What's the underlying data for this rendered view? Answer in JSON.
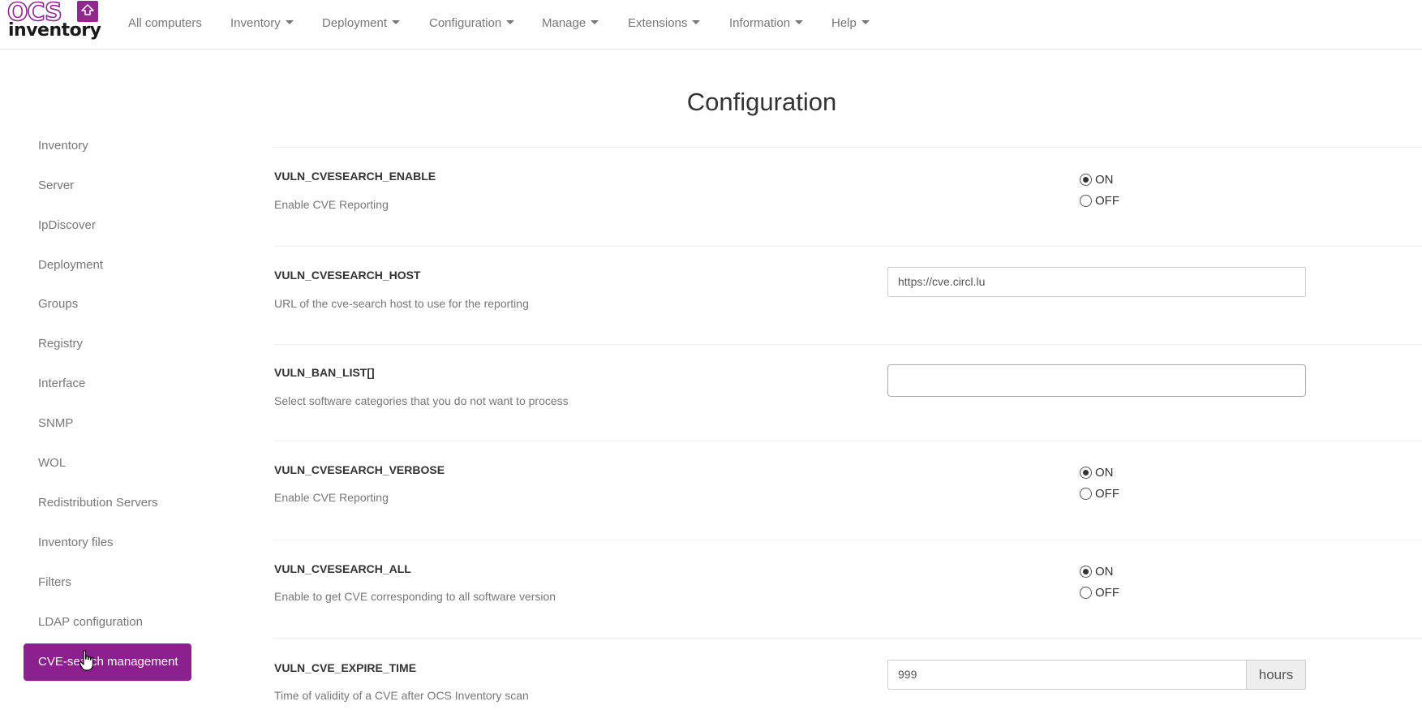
{
  "brand": {
    "logo_top": "OCS",
    "logo_bottom": "inventory",
    "color": "#8e2a8e"
  },
  "nav": {
    "all_computers": "All computers",
    "menus": [
      "Inventory",
      "Deployment",
      "Configuration",
      "Manage",
      "Extensions",
      "Information",
      "Help"
    ]
  },
  "page": {
    "title": "Configuration"
  },
  "sidebar": {
    "items": [
      "Inventory",
      "Server",
      "IpDiscover",
      "Deployment",
      "Groups",
      "Registry",
      "Interface",
      "SNMP",
      "WOL",
      "Redistribution Servers",
      "Inventory files",
      "Filters",
      "LDAP configuration"
    ],
    "active": "CVE-search management",
    "active_color": "#8e1f8e"
  },
  "settings": [
    {
      "name": "VULN_CVESEARCH_ENABLE",
      "desc": "Enable CVE Reporting",
      "type": "radio",
      "on": "ON",
      "off": "OFF",
      "selected": "ON"
    },
    {
      "name": "VULN_CVESEARCH_HOST",
      "desc": "URL of the cve-search host to use for the reporting",
      "type": "text",
      "value": "https://cve.circl.lu"
    },
    {
      "name": "VULN_BAN_LIST[]",
      "desc": "Select software categories that you do not want to process",
      "type": "select",
      "value": ""
    },
    {
      "name": "VULN_CVESEARCH_VERBOSE",
      "desc": "Enable CVE Reporting",
      "type": "radio",
      "on": "ON",
      "off": "OFF",
      "selected": "ON"
    },
    {
      "name": "VULN_CVESEARCH_ALL",
      "desc": "Enable to get CVE corresponding to all software version",
      "type": "radio",
      "on": "ON",
      "off": "OFF",
      "selected": "ON"
    },
    {
      "name": "VULN_CVE_EXPIRE_TIME",
      "desc": "Time of validity of a CVE after OCS Inventory scan",
      "type": "number",
      "value": "999",
      "unit": "hours"
    }
  ]
}
